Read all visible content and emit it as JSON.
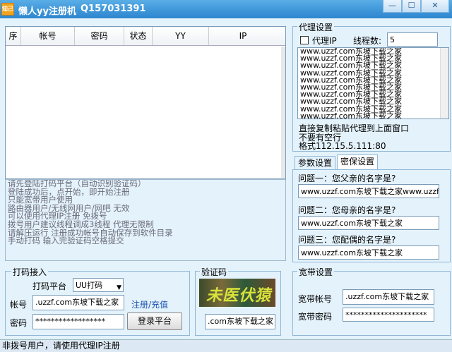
{
  "window": {
    "icon_text": "知己",
    "title": "懒人yy注册机",
    "qq": "Q157031391",
    "min_glyph": "—",
    "max_glyph": "☐",
    "close_glyph": "✕"
  },
  "grid": {
    "columns": [
      "序",
      "帐号",
      "密码",
      "状态",
      "YY",
      "IP"
    ]
  },
  "log": {
    "lines": [
      "请先登陆打码平台（自动识别验证码）",
      "登陆成功后，点开始，即开始注册",
      "只能宽带用户使用",
      "路由器用户/无线网用户/网吧 无效",
      "可以使用代理IP注册 免拨号",
      "拨号用户建议线程调成3线程 代理无限制",
      "请解压运行 注册成功帐号自动保存到软件目录",
      "手动打码 输入完验证码空格提交"
    ]
  },
  "captcha_panel": {
    "legend": "打码接入",
    "platform_label": "打码平台",
    "platform_value": "UU打码",
    "account_label": "帐号",
    "account_value": ".uzzf.com东坡下载之家",
    "register_link": "注册/充值",
    "password_label": "密码",
    "password_value": "******************",
    "login_button": "登录平台"
  },
  "verify_panel": {
    "legend": "验证码",
    "image_text": "未医伏猿",
    "input_value": ".com东坡下载之家"
  },
  "proxy_panel": {
    "legend": "代理设置",
    "use_proxy_label": "代理IP",
    "threads_label": "线程数:",
    "threads_value": "5",
    "proxies": [
      "www.uzzf.com东坡下载之家",
      "www.uzzf.com东坡下载之家",
      "www.uzzf.com东坡下载之家",
      "www.uzzf.com东坡下载之家",
      "www.uzzf.com东坡下载之家",
      "www.uzzf.com东坡下载之家",
      "www.uzzf.com东坡下载之家",
      "www.uzzf.com东坡下载之家",
      "www.uzzf.com东坡下载之家",
      "www.uzzf.com东坡下载之家"
    ],
    "hint1": "直接复制粘贴代理到上面窗口",
    "hint2": "不要有空行",
    "hint3": "格式112.15.5.111:80"
  },
  "tabs": {
    "params": "参数设置",
    "security": "密保设置"
  },
  "security": {
    "q1_label": "问题一：您父亲的名字是?",
    "q1_value": "www.uzzf.com东坡下载之家www.uzzf.com",
    "q2_label": "问题二：您母亲的名字是?",
    "q2_value": "www.uzzf.com东坡下载之家",
    "q3_label": "问题三：您配偶的名字是?",
    "q3_value": "www.uzzf.com东坡下载之家"
  },
  "broadband_panel": {
    "legend": "宽带设置",
    "account_label": "宽带帐号",
    "account_value": ".uzzf.com东坡下载之家",
    "password_label": "宽带密码",
    "password_value": "*********************"
  },
  "status": {
    "text": "非拨号用户，请使用代理IP注册"
  }
}
